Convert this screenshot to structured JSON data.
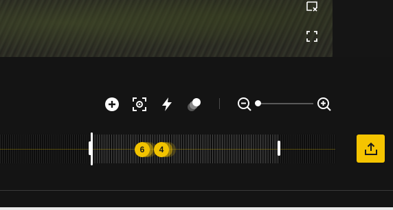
{
  "preview": {
    "icons": [
      "close-caption-icon",
      "fullscreen-icon"
    ]
  },
  "toolbar": {
    "icons": [
      "add-circle-icon",
      "focus-target-icon",
      "flash-icon",
      "color-blend-icon"
    ]
  },
  "zoom": {
    "out_icon": "zoom-out-icon",
    "in_icon": "zoom-in-icon",
    "level": 0.0
  },
  "timeline": {
    "markers": [
      {
        "label": "6"
      },
      {
        "label": "4"
      }
    ]
  },
  "export": {
    "icon": "share-upload-icon"
  },
  "colors": {
    "accent": "#f5c400",
    "background": "#141414",
    "icon": "#ffffff"
  }
}
